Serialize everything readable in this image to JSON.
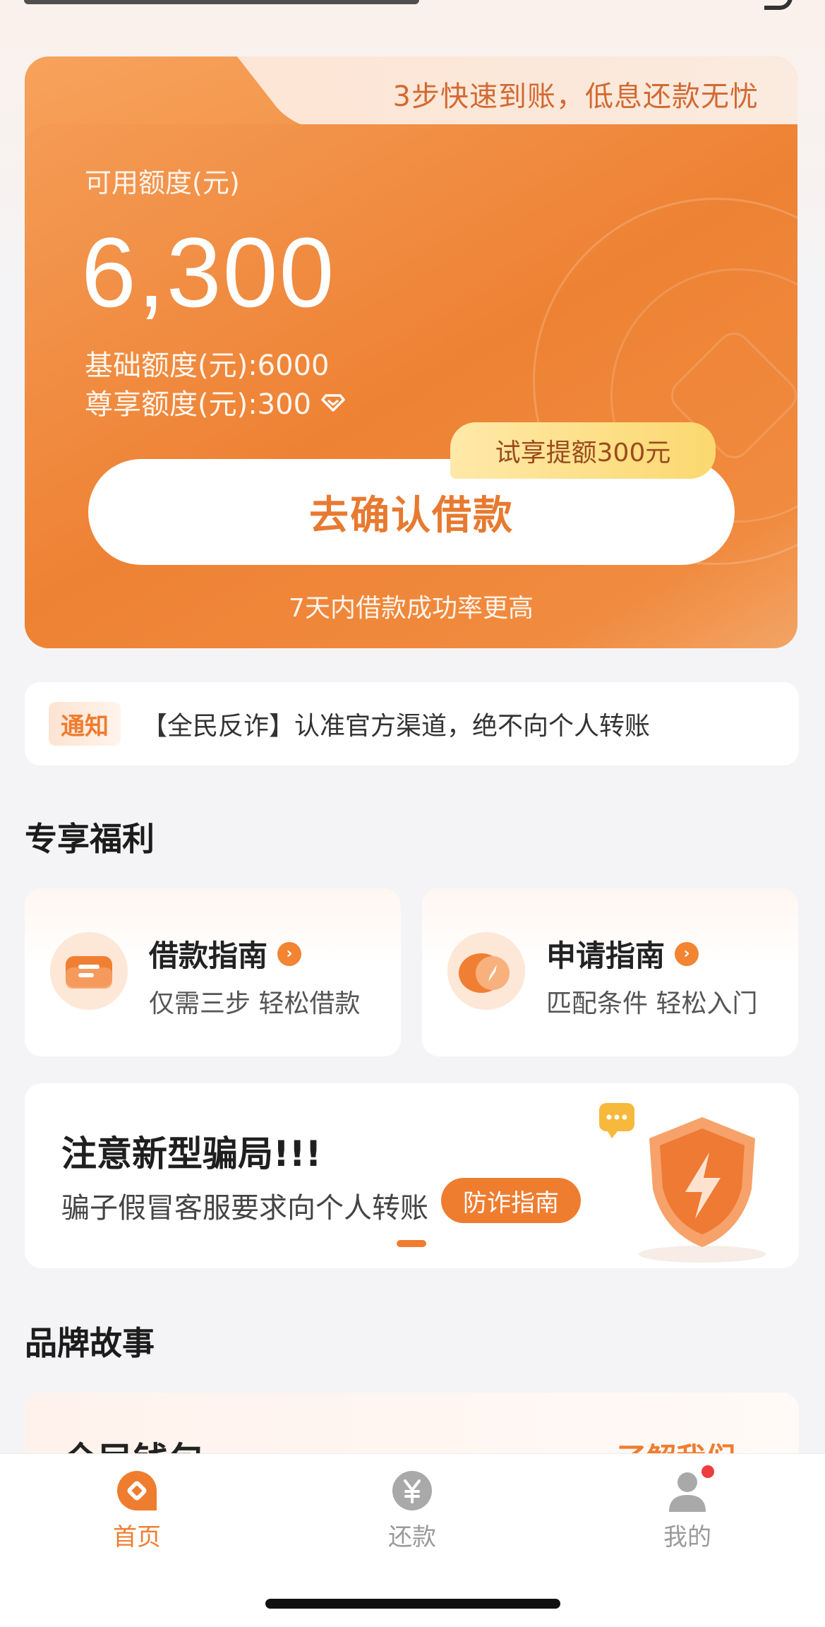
{
  "card": {
    "banner": "3步快速到账，低息还款无忧",
    "available_label": "可用额度(元)",
    "available_amount": "6,300",
    "base_quota": "基础额度(元):6000",
    "vip_quota": "尊享额度(元):300",
    "trial_badge": "试享提额300元",
    "confirm_button": "去确认借款",
    "tip": "7天内借款成功率更高"
  },
  "notice": {
    "tag": "通知",
    "text": "【全民反诈】认准官方渠道，绝不向个人转账"
  },
  "welfare": {
    "title": "专享福利",
    "items": [
      {
        "title": "借款指南",
        "subtitle": "仅需三步 轻松借款",
        "icon": "ticket-icon"
      },
      {
        "title": "申请指南",
        "subtitle": "匹配条件 轻松入门",
        "icon": "compass-icon"
      }
    ]
  },
  "fraud": {
    "title": "注意新型骗局!!!",
    "subtitle": "骗子假冒客服要求向个人转账",
    "button": "防诈指南"
  },
  "brand": {
    "title": "品牌故事",
    "card_title": "全民钱包",
    "link": "了解我们 →"
  },
  "nav": {
    "items": [
      {
        "label": "首页",
        "active": true,
        "icon": "home-icon"
      },
      {
        "label": "还款",
        "active": false,
        "icon": "yuan-icon"
      },
      {
        "label": "我的",
        "active": false,
        "icon": "user-icon"
      }
    ]
  },
  "colors": {
    "accent": "#EF7D30",
    "inactive": "#9A9A9A",
    "badge_dot": "#EE3D3D"
  }
}
